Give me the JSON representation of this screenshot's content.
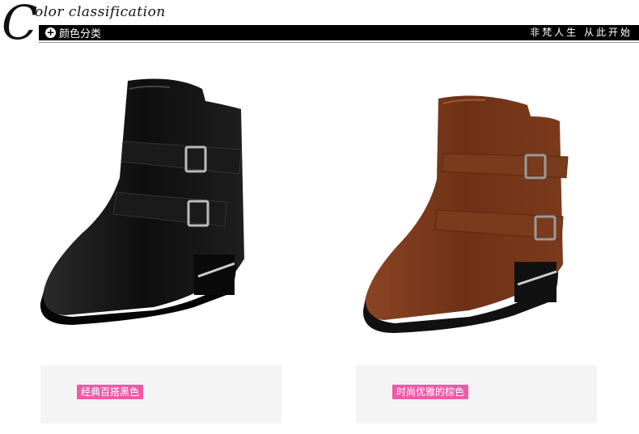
{
  "header": {
    "initial": "C",
    "title": "olor classification",
    "section_label": "颜色分类",
    "slogan": "非梵人生 从此开始",
    "icon": "plus-circle-icon"
  },
  "products": [
    {
      "color_label": "经典百搭黑色",
      "boot_color": "#1a1a1a"
    },
    {
      "color_label": "时尚优雅的棕色",
      "boot_color": "#7a3a1c"
    }
  ],
  "colors": {
    "accent": "#ec5ba8",
    "bar": "#000000",
    "panel": "#f4f4f4"
  }
}
